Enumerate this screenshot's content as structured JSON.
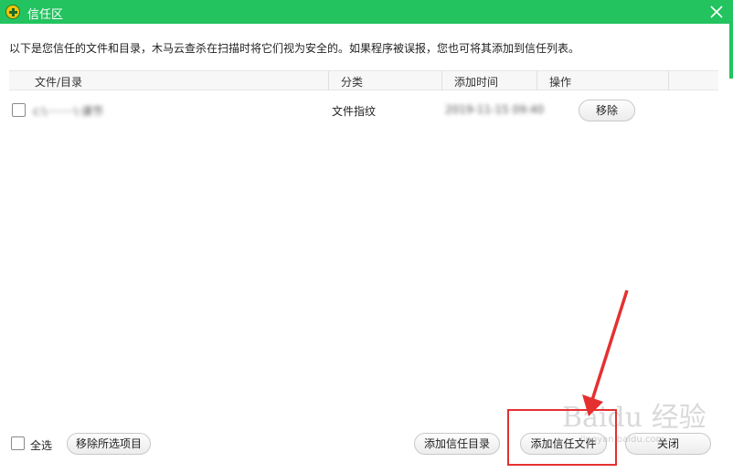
{
  "window": {
    "title": "信任区",
    "close_icon": "close-icon",
    "accent_color": "#23c35f"
  },
  "description": "以下是您信任的文件和目录，木马云查杀在扫描时将它们视为安全的。如果程序被误报，您也可将其添加到信任列表。",
  "table": {
    "columns": [
      "文件/目录",
      "分类",
      "添加时间",
      "操作"
    ],
    "rows": [
      {
        "checked": false,
        "path": "c:\\········\\·课节",
        "category": "文件指纹",
        "time": "2019-11-15 09:40",
        "action": "移除"
      }
    ]
  },
  "footer": {
    "select_all": "全选",
    "remove_selected": "移除所选项目",
    "add_trusted_dir": "添加信任目录",
    "add_trusted_file": "添加信任文件",
    "close": "关闭"
  },
  "watermark": {
    "text": "Baidu 经验",
    "sub": "jingyan.baidu.com"
  },
  "annotation_color": "#e53030"
}
